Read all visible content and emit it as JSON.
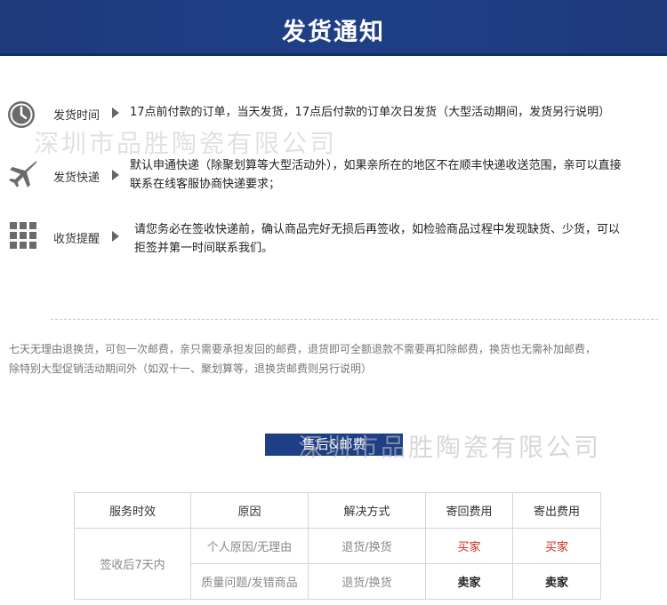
{
  "banner": {
    "title": "发货通知"
  },
  "watermark": "深圳市品胜陶瓷有限公司",
  "rows": [
    {
      "icon": "clock-icon",
      "label": "发货时间",
      "lines": [
        "17点前付款的订单，当天发货，17点后付款的订单次日发货（大型活动期间，发货另行说明）"
      ]
    },
    {
      "icon": "airplane-icon",
      "label": "发货快递",
      "lines": [
        "默认申通快递（除聚划算等大型活动外），如果亲所在的地区不在顺丰快递收送范围，亲可以直接",
        "联系在线客服协商快递要求；"
      ]
    },
    {
      "icon": "grid-icon",
      "label": "收货提醒",
      "lines": [
        "请您务必在签收快递前，确认商品完好无损后再签收，如检验商品过程中发现缺货、少货，可以",
        "拒签并第一时间联系我们。"
      ]
    }
  ],
  "policy": {
    "lines": [
      "七天无理由退换货，可包一次邮费，亲只需要承担发回的邮费，退货即可全额退款不需要再扣除邮费，换货也无需补加邮费，",
      "除特别大型促销活动期间外（如双十一、聚划算等，退换货邮费则另行说明）"
    ]
  },
  "section": {
    "title": "售后&邮费"
  },
  "table": {
    "headers": [
      "服务时效",
      "原因",
      "解决方式",
      "寄回费用",
      "寄出费用"
    ],
    "period": "签收后7天内",
    "rows": [
      {
        "reason": "个人原因/无理由",
        "solution": "退货/换货",
        "return_fee": "买家",
        "send_fee": "买家"
      },
      {
        "reason": "质量问题/发错商品",
        "solution": "退货/换货",
        "return_fee": "卖家",
        "send_fee": "卖家"
      }
    ]
  },
  "colors": {
    "banner": "#1e3f86",
    "accent_red": "#cc2a1a"
  }
}
